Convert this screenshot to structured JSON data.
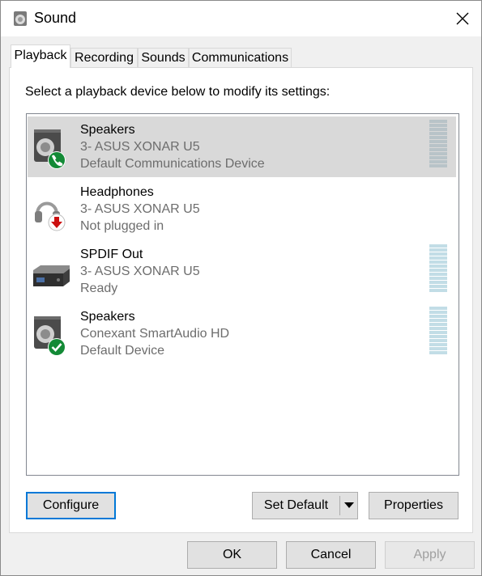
{
  "window": {
    "title": "Sound",
    "icon": "speaker-icon",
    "close_icon": "close-icon"
  },
  "tabs": [
    {
      "label": "Playback",
      "active": true
    },
    {
      "label": "Recording",
      "active": false
    },
    {
      "label": "Sounds",
      "active": false
    },
    {
      "label": "Communications",
      "active": false
    }
  ],
  "playback": {
    "instructions": "Select a playback device below to modify its settings:",
    "devices": [
      {
        "name": "Speakers",
        "line2": "3- ASUS XONAR U5",
        "line3": "Default Communications Device",
        "icon": "speaker-phone-icon",
        "selected": true,
        "meter": true
      },
      {
        "name": "Headphones",
        "line2": "3- ASUS XONAR U5",
        "line3": "Not plugged in",
        "icon": "headphones-unplugged-icon",
        "selected": false,
        "meter": false
      },
      {
        "name": "SPDIF Out",
        "line2": "3- ASUS XONAR U5",
        "line3": "Ready",
        "icon": "spdif-device-icon",
        "selected": false,
        "meter": true
      },
      {
        "name": "Speakers",
        "line2": "Conexant SmartAudio HD",
        "line3": "Default Device",
        "icon": "speaker-default-icon",
        "selected": false,
        "meter": true
      }
    ],
    "configure_label": "Configure",
    "set_default_label": "Set Default",
    "properties_label": "Properties"
  },
  "footer": {
    "ok_label": "OK",
    "cancel_label": "Cancel",
    "apply_label": "Apply"
  },
  "colors": {
    "selection": "#d9d9d9",
    "focus_border": "#0078d7",
    "badge_green": "#0f9d0f",
    "badge_red": "#cc1111",
    "meter": "#c2dde6"
  }
}
